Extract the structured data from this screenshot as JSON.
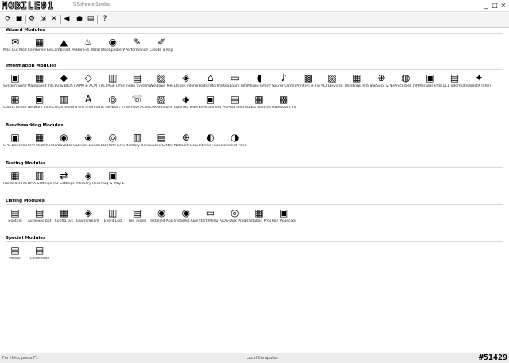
{
  "window": {
    "logo_text": "MOBILE01",
    "title": "SiSoftware Sandra",
    "controls": {
      "minimize": "_",
      "maximize": "□",
      "close": "×"
    }
  },
  "toolbar": {
    "buttons": [
      {
        "icon": "refresh-icon",
        "glyph": "⟳"
      },
      {
        "icon": "report-icon",
        "glyph": "▣"
      },
      {
        "icon": "options-icon",
        "glyph": "⚙"
      },
      {
        "icon": "export-icon",
        "glyph": "⇲"
      },
      {
        "icon": "delete-icon",
        "glyph": "✕"
      },
      {
        "icon": "back-icon",
        "glyph": "◀"
      },
      {
        "icon": "stop-icon",
        "glyph": "●"
      },
      {
        "icon": "view-icon",
        "glyph": "▤"
      },
      {
        "icon": "help-icon",
        "glyph": "?"
      }
    ]
  },
  "sections": [
    {
      "title": "Wizard Modules",
      "items": [
        {
          "label": "Mail Out Module",
          "icon": "✉"
        },
        {
          "label": "Combined Benchmark",
          "icon": "▦"
        },
        {
          "label": "Combined Performance",
          "icon": "▲"
        },
        {
          "label": "Burn-in Wizard",
          "icon": "♨"
        },
        {
          "label": "WebUpdate Wizard",
          "icon": "◉"
        },
        {
          "label": "Performance Tune-up",
          "icon": "✎"
        },
        {
          "label": "Create a Report Wizard",
          "icon": "✐"
        }
      ]
    },
    {
      "title": "Information Modules",
      "items": [
        {
          "label": "System Summary",
          "icon": "▣"
        },
        {
          "label": "Mainboard Information",
          "icon": "▦"
        },
        {
          "label": "CPU & BIOS Information",
          "icon": "◆"
        },
        {
          "label": "APM & ACPI Information",
          "icon": "◇"
        },
        {
          "label": "PCI/AGP Information",
          "icon": "▥"
        },
        {
          "label": "Video System Information",
          "icon": "▤"
        },
        {
          "label": "Windows Memory",
          "icon": "▨"
        },
        {
          "label": "Drives Information",
          "icon": "◈"
        },
        {
          "label": "Ports Information",
          "icon": "⌂"
        },
        {
          "label": "Keyboard Information",
          "icon": "▭"
        },
        {
          "label": "Mouse Information",
          "icon": "◖"
        },
        {
          "label": "Sound Card Information",
          "icon": "♪"
        },
        {
          "label": "Printers & Fax Information",
          "icon": "▩"
        },
        {
          "label": "MCI Devices Information",
          "icon": "▧"
        },
        {
          "label": "Windows Information",
          "icon": "▦"
        },
        {
          "label": "WinSock & Network",
          "icon": "⊕"
        },
        {
          "label": "Processes Information",
          "icon": "◍"
        },
        {
          "label": "Modules Information",
          "icon": "▣"
        },
        {
          "label": "DLL Information",
          "icon": "▤"
        },
        {
          "label": "DirectX Information",
          "icon": "✦"
        },
        {
          "label": "Courts Information",
          "icon": "▦"
        },
        {
          "label": "Network Information",
          "icon": "▣"
        },
        {
          "label": "CMOS Information",
          "icon": "▥"
        },
        {
          "label": "Font Information",
          "icon": "A"
        },
        {
          "label": "IE Network Information",
          "icon": "◎"
        },
        {
          "label": "Remote Access Information",
          "icon": "☏"
        },
        {
          "label": "CMOS Information",
          "icon": "▨"
        },
        {
          "label": "OpenGL Video Information",
          "icon": "◈"
        },
        {
          "label": "Environment Information",
          "icon": "▣"
        },
        {
          "label": "ASPI32 Information",
          "icon": "▤"
        },
        {
          "label": "Data Sources Information",
          "icon": "▦"
        },
        {
          "label": "Mainboard Information",
          "icon": "▩"
        }
      ]
    },
    {
      "title": "Benchmarking Modules",
      "items": [
        {
          "label": "CPU Benchmark",
          "icon": "▣"
        },
        {
          "label": "CPU Multimedia",
          "icon": "▦"
        },
        {
          "label": "Removable Storage",
          "icon": "◉"
        },
        {
          "label": "Drives Benchmark",
          "icon": "◈"
        },
        {
          "label": "CD-ROM Benchmark",
          "icon": "◎"
        },
        {
          "label": "Memory Benchmark",
          "icon": "▥"
        },
        {
          "label": "Cache & Memory",
          "icon": "▤"
        },
        {
          "label": "Network Benchmark",
          "icon": "⊕"
        },
        {
          "label": "Internet Connection",
          "icon": "◐"
        },
        {
          "label": "Internet Peerage",
          "icon": "◑"
        }
      ]
    },
    {
      "title": "Testing Modules",
      "items": [
        {
          "label": "Hardware IRQ Settings",
          "icon": "▦"
        },
        {
          "label": "DMA Settings",
          "icon": "▥"
        },
        {
          "label": "I/O Settings",
          "icon": "⇄"
        },
        {
          "label": "Memory Resources",
          "icon": "◈"
        },
        {
          "label": "Plug & Play Enumerator",
          "icon": "▣"
        }
      ]
    },
    {
      "title": "Listing Modules",
      "items": [
        {
          "label": "Boot.ini",
          "icon": "▤"
        },
        {
          "label": "autoexec.bat",
          "icon": "▤"
        },
        {
          "label": "Config.sys",
          "icon": "▦"
        },
        {
          "label": "Environment Variables",
          "icon": "◈"
        },
        {
          "label": "Event Log",
          "icon": "▥"
        },
        {
          "label": "File Types",
          "icon": "▤"
        },
        {
          "label": "Installed Applications",
          "icon": "◉"
        },
        {
          "label": "Installed Applications",
          "icon": "◉"
        },
        {
          "label": "Start Menu Applications",
          "icon": "▭"
        },
        {
          "label": "On-Disk Program Info",
          "icon": "◎"
        },
        {
          "label": "Installed Programs",
          "icon": "▦"
        },
        {
          "label": "Run Applications",
          "icon": "▣"
        }
      ]
    },
    {
      "title": "Special Modules",
      "items": [
        {
          "label": "Version",
          "icon": "▤"
        },
        {
          "label": "Comments",
          "icon": "▤"
        }
      ]
    }
  ],
  "statusbar": {
    "left": "For Help, press F1",
    "middle": "Local Computer",
    "watermark": "#51429"
  }
}
